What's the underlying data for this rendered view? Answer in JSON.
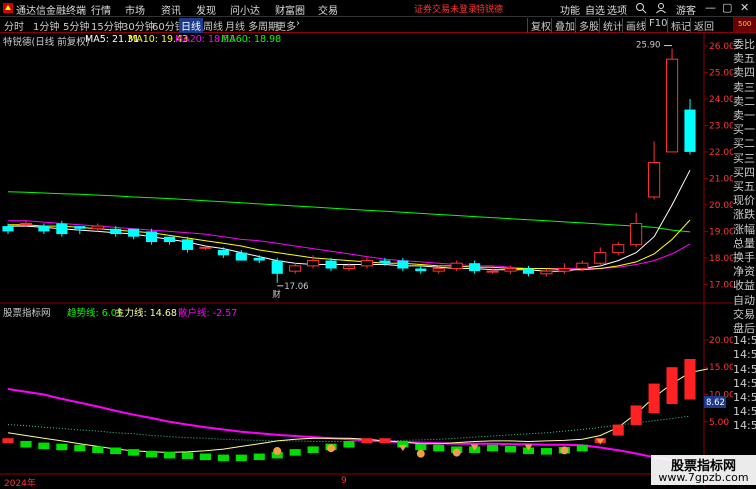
{
  "app": {
    "title": "通达信金融终端",
    "menus": [
      "行情",
      "市场",
      "资讯",
      "发现",
      "问小达",
      "财富圈",
      "交易"
    ],
    "login_notice": "证券交易未登录",
    "stock_name": "特锐德",
    "right_menus": [
      "功能",
      "自选",
      "选项"
    ],
    "guest": "游客",
    "window_buttons": [
      "—",
      "▢",
      "✕"
    ]
  },
  "toolbar": {
    "periods": [
      "分时",
      "1分钟",
      "5分钟",
      "15分钟",
      "30分钟",
      "60分钟",
      "日线",
      "周线",
      "月线",
      "多周期",
      "更多"
    ],
    "active_period": "日线",
    "more_arrow": "›",
    "tools": [
      "复权",
      "叠加",
      "多股",
      "统计",
      "画线",
      "F10",
      "标记",
      "返回"
    ]
  },
  "main_chart": {
    "name": "特锐德(日线 前复权)",
    "ma": [
      {
        "label": "MA5: 21.31",
        "color": "#ffffff"
      },
      {
        "label": "MA10: 19.43",
        "color": "#ffff00"
      },
      {
        "label": "MA20: 18.53",
        "color": "#ff00ff"
      },
      {
        "label": "MA60: 18.98",
        "color": "#00ff00"
      }
    ],
    "y_ticks": [
      "26.00",
      "25.00",
      "24.00",
      "23.00",
      "22.00",
      "21.00",
      "20.00",
      "19.00",
      "18.00",
      "17.00"
    ],
    "high_label": "25.90",
    "low_label": "17.06",
    "event_mark": "财"
  },
  "sub_chart": {
    "name": "股票指标网",
    "lines": [
      {
        "label": "趋势线: 6.05",
        "color": "#00ff00"
      },
      {
        "label": "主力线: 14.68",
        "color": "#ffff99"
      },
      {
        "label": "散户线: -2.57",
        "color": "#ff00ff"
      }
    ],
    "y_ticks": [
      "20.00",
      "15.00",
      "10.00",
      "5.00"
    ],
    "current_value": "8.62"
  },
  "bottom": {
    "year": "2024年",
    "month": "9"
  },
  "right_panel": {
    "items": [
      "委比",
      "卖五",
      "卖四",
      "卖三",
      "卖二",
      "卖一",
      "买一",
      "买二",
      "买三",
      "买四",
      "买五",
      "现价",
      "涨跌",
      "涨幅",
      "总量",
      "换手",
      "净资",
      "收益",
      "自动",
      "交易",
      "盘后",
      "14:50",
      "14:50",
      "14:50",
      "14:50",
      "14:50",
      "14:50",
      "14:50"
    ],
    "top_tag": "500"
  },
  "watermark": {
    "line1": "股票指标网",
    "line2": "www.7gpzb.com"
  },
  "chart_data": {
    "type": "candlestick",
    "ylim": [
      16.6,
      26.3
    ],
    "candles": [
      {
        "o": 19.2,
        "c": 19.0,
        "h": 19.3,
        "l": 18.9
      },
      {
        "o": 19.3,
        "c": 19.3,
        "h": 19.4,
        "l": 19.2
      },
      {
        "o": 19.2,
        "c": 19.0,
        "h": 19.3,
        "l": 18.9
      },
      {
        "o": 19.3,
        "c": 18.9,
        "h": 19.4,
        "l": 18.8
      },
      {
        "o": 19.2,
        "c": 19.1,
        "h": 19.2,
        "l": 18.9
      },
      {
        "o": 19.1,
        "c": 19.2,
        "h": 19.3,
        "l": 19.0
      },
      {
        "o": 19.1,
        "c": 18.9,
        "h": 19.2,
        "l": 18.8
      },
      {
        "o": 19.1,
        "c": 18.8,
        "h": 19.1,
        "l": 18.7
      },
      {
        "o": 19.0,
        "c": 18.6,
        "h": 19.1,
        "l": 18.5
      },
      {
        "o": 18.8,
        "c": 18.6,
        "h": 18.8,
        "l": 18.5
      },
      {
        "o": 18.7,
        "c": 18.3,
        "h": 18.8,
        "l": 18.2
      },
      {
        "o": 18.4,
        "c": 18.4,
        "h": 18.5,
        "l": 18.3
      },
      {
        "o": 18.3,
        "c": 18.1,
        "h": 18.4,
        "l": 18.0
      },
      {
        "o": 18.2,
        "c": 17.9,
        "h": 18.3,
        "l": 17.9
      },
      {
        "o": 18.0,
        "c": 17.9,
        "h": 18.1,
        "l": 17.8
      },
      {
        "o": 17.9,
        "c": 17.4,
        "h": 18.0,
        "l": 17.06
      },
      {
        "o": 17.5,
        "c": 17.7,
        "h": 17.8,
        "l": 17.4
      },
      {
        "o": 17.7,
        "c": 17.9,
        "h": 18.1,
        "l": 17.6
      },
      {
        "o": 17.9,
        "c": 17.6,
        "h": 18.0,
        "l": 17.5
      },
      {
        "o": 17.6,
        "c": 17.7,
        "h": 17.8,
        "l": 17.5
      },
      {
        "o": 17.7,
        "c": 17.9,
        "h": 18.0,
        "l": 17.6
      },
      {
        "o": 17.9,
        "c": 17.8,
        "h": 18.0,
        "l": 17.7
      },
      {
        "o": 17.9,
        "c": 17.6,
        "h": 18.0,
        "l": 17.5
      },
      {
        "o": 17.6,
        "c": 17.5,
        "h": 17.7,
        "l": 17.4
      },
      {
        "o": 17.5,
        "c": 17.6,
        "h": 17.7,
        "l": 17.4
      },
      {
        "o": 17.6,
        "c": 17.8,
        "h": 17.9,
        "l": 17.5
      },
      {
        "o": 17.8,
        "c": 17.5,
        "h": 17.9,
        "l": 17.4
      },
      {
        "o": 17.5,
        "c": 17.5,
        "h": 17.6,
        "l": 17.4
      },
      {
        "o": 17.5,
        "c": 17.6,
        "h": 17.7,
        "l": 17.4
      },
      {
        "o": 17.6,
        "c": 17.4,
        "h": 17.7,
        "l": 17.3
      },
      {
        "o": 17.4,
        "c": 17.5,
        "h": 17.6,
        "l": 17.3
      },
      {
        "o": 17.5,
        "c": 17.6,
        "h": 17.8,
        "l": 17.4
      },
      {
        "o": 17.6,
        "c": 17.8,
        "h": 17.9,
        "l": 17.5
      },
      {
        "o": 17.8,
        "c": 18.2,
        "h": 18.4,
        "l": 17.7
      },
      {
        "o": 18.2,
        "c": 18.5,
        "h": 18.6,
        "l": 18.1
      },
      {
        "o": 18.5,
        "c": 19.3,
        "h": 19.7,
        "l": 18.4
      },
      {
        "o": 20.3,
        "c": 21.6,
        "h": 22.4,
        "l": 20.2
      },
      {
        "o": 22.0,
        "c": 25.5,
        "h": 25.9,
        "l": 22.0
      },
      {
        "o": 23.6,
        "c": 22.0,
        "h": 24.0,
        "l": 21.9
      }
    ],
    "ma5": [
      19.2,
      19.2,
      19.15,
      19.1,
      19.05,
      19.0,
      18.95,
      18.9,
      18.8,
      18.7,
      18.6,
      18.45,
      18.35,
      18.2,
      18.05,
      17.9,
      17.8,
      17.75,
      17.75,
      17.75,
      17.75,
      17.75,
      17.7,
      17.7,
      17.65,
      17.6,
      17.6,
      17.55,
      17.55,
      17.55,
      17.5,
      17.5,
      17.6,
      17.7,
      17.9,
      18.2,
      18.8,
      20.0,
      21.31
    ],
    "ma10": [
      19.25,
      19.25,
      19.2,
      19.2,
      19.15,
      19.1,
      19.05,
      19.0,
      18.95,
      18.85,
      18.75,
      18.65,
      18.55,
      18.45,
      18.3,
      18.2,
      18.1,
      18.0,
      17.95,
      17.9,
      17.85,
      17.8,
      17.8,
      17.75,
      17.7,
      17.7,
      17.65,
      17.65,
      17.6,
      17.6,
      17.6,
      17.55,
      17.55,
      17.6,
      17.7,
      17.85,
      18.15,
      18.7,
      19.43
    ],
    "ma20": [
      19.4,
      19.4,
      19.35,
      19.3,
      19.25,
      19.2,
      19.15,
      19.1,
      19.05,
      19.0,
      18.95,
      18.9,
      18.8,
      18.7,
      18.65,
      18.55,
      18.45,
      18.35,
      18.25,
      18.15,
      18.05,
      17.95,
      17.9,
      17.85,
      17.8,
      17.75,
      17.7,
      17.7,
      17.65,
      17.6,
      17.6,
      17.6,
      17.6,
      17.6,
      17.65,
      17.75,
      17.9,
      18.15,
      18.53
    ],
    "ma60": [
      20.5,
      20.48,
      20.45,
      20.42,
      20.4,
      20.37,
      20.34,
      20.3,
      20.27,
      20.24,
      20.2,
      20.16,
      20.12,
      20.08,
      20.04,
      20.0,
      19.96,
      19.92,
      19.88,
      19.84,
      19.8,
      19.76,
      19.72,
      19.68,
      19.64,
      19.6,
      19.56,
      19.52,
      19.48,
      19.44,
      19.4,
      19.36,
      19.32,
      19.28,
      19.24,
      19.2,
      19.15,
      19.05,
      18.98
    ],
    "sub_ylim": [
      -4,
      24
    ],
    "trend_bars": [
      2.0,
      1.5,
      1.2,
      1.0,
      0.8,
      0.5,
      0.3,
      0.0,
      -0.3,
      -0.5,
      -0.6,
      -0.8,
      -1.0,
      -1.0,
      -0.8,
      -0.5,
      0.0,
      0.5,
      1.0,
      1.5,
      2.0,
      2.0,
      1.5,
      1.0,
      0.8,
      0.5,
      0.5,
      0.8,
      0.6,
      0.3,
      0.2,
      0.4,
      0.8,
      2.0,
      4.5,
      8.0,
      12.0,
      15.0,
      16.5,
      19.0,
      20.5,
      18.0,
      16.0
    ],
    "main_line": [
      3.0,
      2.5,
      2.0,
      1.5,
      1.0,
      0.5,
      0.0,
      -0.3,
      -0.5,
      -0.6,
      -0.5,
      -0.3,
      0.0,
      0.5,
      1.0,
      1.5,
      1.8,
      2.0,
      2.0,
      2.0,
      1.8,
      1.5,
      1.3,
      1.0,
      1.0,
      1.2,
      1.4,
      1.5,
      1.5,
      1.4,
      1.5,
      1.6,
      1.8,
      2.5,
      4.0,
      6.5,
      9.5,
      12.0,
      14.0,
      14.68
    ],
    "retail_line": [
      11.0,
      10.5,
      10.0,
      9.2,
      8.5,
      7.8,
      7.0,
      6.3,
      5.7,
      5.0,
      4.5,
      4.0,
      3.6,
      3.2,
      2.9,
      2.6,
      2.4,
      2.2,
      2.0,
      1.8,
      1.6,
      1.4,
      1.3,
      1.2,
      1.1,
      1.0,
      1.0,
      1.0,
      0.9,
      0.9,
      0.8,
      0.8,
      0.7,
      0.3,
      -0.2,
      -0.8,
      -1.5,
      -2.0,
      -2.57
    ],
    "dotted_line": [
      4.5,
      4.3,
      4.0,
      3.8,
      3.5,
      3.3,
      3.0,
      2.8,
      2.5,
      2.3,
      2.1,
      2.0,
      1.8,
      1.7,
      1.6,
      1.5,
      1.5,
      1.4,
      1.4,
      1.4,
      1.5,
      1.5,
      1.6,
      1.7,
      1.8,
      2.0,
      2.2,
      2.4,
      2.6,
      2.8,
      3.0,
      3.3,
      3.6,
      4.0,
      4.4,
      4.8,
      5.2,
      5.6,
      6.05
    ]
  }
}
